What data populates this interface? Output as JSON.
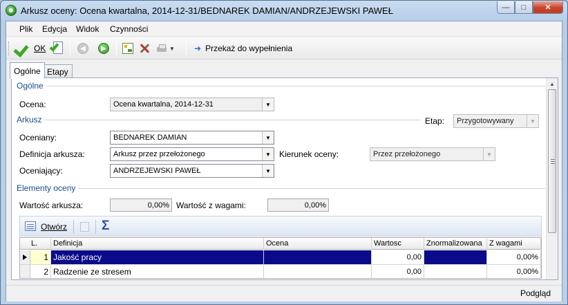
{
  "window": {
    "title": "Arkusz oceny: Ocena kwartalna, 2014-12-31/BEDNAREK DAMIAN/ANDRZEJEWSKI PAWEŁ"
  },
  "menu": {
    "items": [
      "Plik",
      "Edycja",
      "Widok",
      "Czynności"
    ]
  },
  "toolbar": {
    "ok_label": "OK",
    "forward_label": "Przekaż do wypełnienia"
  },
  "tabs": [
    "Ogólne",
    "Etapy"
  ],
  "form": {
    "section_general": "Ogólne",
    "ocena_label": "Ocena:",
    "ocena_value": "Ocena kwartalna, 2014-12-31",
    "section_sheet": "Arkusz",
    "etap_label": "Etap:",
    "etap_value": "Przygotowywany",
    "oceniany_label": "Oceniany:",
    "oceniany_value": "BEDNAREK DAMIAN",
    "definicja_label": "Definicja arkusza:",
    "definicja_value": "Arkusz przez przełożonego",
    "kierunek_label": "Kierunek oceny:",
    "kierunek_value": "Przez przełożonego",
    "oceniajacy_label": "Oceniający:",
    "oceniajacy_value": "ANDRZEJEWSKI PAWEŁ",
    "section_elements": "Elementy oceny",
    "wartosc_arkusza_label": "Wartość arkusza:",
    "wartosc_arkusza_value": "0,00%",
    "wartosc_wagi_label": "Wartość z wagami:",
    "wartosc_wagi_value": "0,00%"
  },
  "grid_toolbar": {
    "open_label": "Otwórz"
  },
  "grid": {
    "headers": [
      "L.",
      "Definicja",
      "Ocena",
      "Wartosc",
      "Znormalizowana",
      "Z wagami"
    ],
    "rows": [
      {
        "lp": "1",
        "definicja": "Jakość pracy",
        "ocena": "",
        "wartosc": "0,00",
        "znorm": "",
        "wagi": "0,00%"
      },
      {
        "lp": "2",
        "definicja": "Radzenie ze stresem",
        "ocena": "",
        "wartosc": "0,00",
        "znorm": "",
        "wagi": "0,00%"
      }
    ]
  },
  "status": {
    "preview_label": "Podgląd"
  }
}
